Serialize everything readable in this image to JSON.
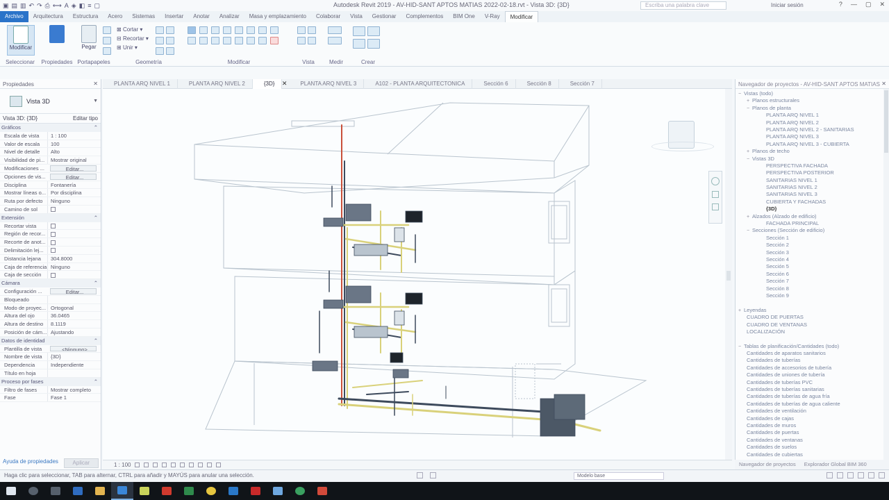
{
  "window": {
    "title": "Autodesk Revit 2019 - AV-HID-SANT APTOS MATIAS 2022-02-18.rvt - Vista 3D: {3D}",
    "search_placeholder": "Escriba una palabra clave",
    "user": "Iniciar sesión"
  },
  "ribbon_tabs": [
    "Archivo",
    "Arquitectura",
    "Estructura",
    "Acero",
    "Sistemas",
    "Insertar",
    "Anotar",
    "Analizar",
    "Masa y emplazamiento",
    "Colaborar",
    "Vista",
    "Gestionar",
    "Complementos",
    "BIM One",
    "V-Ray",
    "Modificar"
  ],
  "ribbon_groups": {
    "select": "Seleccionar",
    "properties": "Propiedades",
    "clipboard": "Portapapeles",
    "geometry": "Geometría",
    "modify": "Modificar",
    "view": "Vista",
    "measure": "Medir",
    "create": "Crear",
    "modify_btn": "Modificar",
    "paste_btn": "Pegar",
    "cut_label": "Recortar",
    "join_label": "Unir",
    "cope_label": "Cortar"
  },
  "properties": {
    "header": "Propiedades",
    "type_name": "Vista 3D",
    "view_selector": "Vista 3D: {3D}",
    "edit_type": "Editar tipo",
    "rows": [
      {
        "cat": "Gráficos"
      },
      {
        "k": "Escala de vista",
        "v": "1 : 100"
      },
      {
        "k": "Valor de escala",
        "v": "100"
      },
      {
        "k": "Nivel de detalle",
        "v": "Alto"
      },
      {
        "k": "Visibilidad de pi...",
        "v": "Mostrar original"
      },
      {
        "k": "Modificaciones ...",
        "v": "Editar...",
        "btn": true
      },
      {
        "k": "Opciones de vis...",
        "v": "Editar...",
        "btn": true
      },
      {
        "k": "Disciplina",
        "v": "Fontanería"
      },
      {
        "k": "Mostrar líneas o...",
        "v": "Por disciplina"
      },
      {
        "k": "Ruta por defecto",
        "v": "Ninguno"
      },
      {
        "k": "Camino de sol",
        "v": "",
        "cb": true
      },
      {
        "cat": "Extensión"
      },
      {
        "k": "Recortar vista",
        "v": "",
        "cb": true
      },
      {
        "k": "Región de recor...",
        "v": "",
        "cb": true
      },
      {
        "k": "Recorte de anot...",
        "v": "",
        "cb": true
      },
      {
        "k": "Delimitación lej...",
        "v": "",
        "cb": true
      },
      {
        "k": "Distancia lejana",
        "v": "304.8000"
      },
      {
        "k": "Caja de referencia",
        "v": "Ninguno"
      },
      {
        "k": "Caja de sección",
        "v": "",
        "cb": true
      },
      {
        "cat": "Cámara"
      },
      {
        "k": "Configuración ...",
        "v": "Editar...",
        "btn": true
      },
      {
        "k": "Bloqueado",
        "v": ""
      },
      {
        "k": "Modo de proyec...",
        "v": "Ortogonal"
      },
      {
        "k": "Altura del ojo",
        "v": "36.0465"
      },
      {
        "k": "Altura de destino",
        "v": "8.1119"
      },
      {
        "k": "Posición de cám...",
        "v": "Ajustando"
      },
      {
        "cat": "Datos de identidad"
      },
      {
        "k": "Plantilla de vista",
        "v": "<Ninguno>",
        "btn": true
      },
      {
        "k": "Nombre de vista",
        "v": "{3D}"
      },
      {
        "k": "Dependencia",
        "v": "Independiente"
      },
      {
        "k": "Título en hoja",
        "v": ""
      },
      {
        "cat": "Proceso por fases"
      },
      {
        "k": "Filtro de fases",
        "v": "Mostrar completo"
      },
      {
        "k": "Fase",
        "v": "Fase 1"
      }
    ],
    "help_link": "Ayuda de propiedades",
    "apply": "Aplicar"
  },
  "view_tabs": [
    {
      "label": "PLANTA ARQ NIVEL 1"
    },
    {
      "label": "PLANTA ARQ NIVEL 2"
    },
    {
      "label": "{3D}",
      "active": true
    },
    {
      "label": "PLANTA ARQ NIVEL 3"
    },
    {
      "label": "A102 - PLANTA ARQUITECTONICA"
    },
    {
      "label": "Sección 6"
    },
    {
      "label": "Sección 8"
    },
    {
      "label": "Sección 7"
    }
  ],
  "view_scale": "1 : 100",
  "browser": {
    "header": "Navegador de proyectos - AV-HID-SANT APTOS MATIAS",
    "items": [
      {
        "t": "Vistas (todo)",
        "l": 0,
        "tog": "−"
      },
      {
        "t": "Planos estructurales",
        "l": 1,
        "tog": "+"
      },
      {
        "t": "Planos de planta",
        "l": 1,
        "tog": "−"
      },
      {
        "t": "PLANTA ARQ NIVEL 1",
        "l": 2
      },
      {
        "t": "PLANTA ARQ NIVEL 2",
        "l": 2
      },
      {
        "t": "PLANTA ARQ NIVEL 2 - SANITARIAS",
        "l": 2
      },
      {
        "t": "PLANTA ARQ NIVEL 3",
        "l": 2
      },
      {
        "t": "PLANTA ARQ NIVEL 3 - CUBIERTA",
        "l": 2
      },
      {
        "t": "Planos de techo",
        "l": 1,
        "tog": "+"
      },
      {
        "t": "Vistas 3D",
        "l": 1,
        "tog": "−"
      },
      {
        "t": "PERSPECTIVA FACHADA",
        "l": 2
      },
      {
        "t": "PERSPECTIVA POSTERIOR",
        "l": 2
      },
      {
        "t": "SANITARIAS NIVEL 1",
        "l": 2
      },
      {
        "t": "SANITARIAS NIVEL 2",
        "l": 2
      },
      {
        "t": "SANITARIAS NIVEL 3",
        "l": 2
      },
      {
        "t": "CUBIERTA Y FACHADAS",
        "l": 2
      },
      {
        "t": "{3D}",
        "l": 2,
        "bold": true
      },
      {
        "t": "Alzados (Alzado de edificio)",
        "l": 1,
        "tog": "+"
      },
      {
        "t": "FACHADA PRINCIPAL",
        "l": 2
      },
      {
        "t": "Secciones (Sección de edificio)",
        "l": 1,
        "tog": "−"
      },
      {
        "t": "Sección 1",
        "l": 2
      },
      {
        "t": "Sección 2",
        "l": 2
      },
      {
        "t": "Sección 3",
        "l": 2
      },
      {
        "t": "Sección 4",
        "l": 2
      },
      {
        "t": "Sección 5",
        "l": 2
      },
      {
        "t": "Sección 6",
        "l": 2
      },
      {
        "t": "Sección 7",
        "l": 2
      },
      {
        "t": "Sección 8",
        "l": 2
      },
      {
        "t": "Sección 9",
        "l": 2
      },
      {
        "t": "",
        "l": 0
      },
      {
        "t": "Leyendas",
        "l": 0,
        "tog": "+"
      },
      {
        "t": "CUADRO DE PUERTAS",
        "l": 1
      },
      {
        "t": "CUADRO DE VENTANAS",
        "l": 1
      },
      {
        "t": "LOCALIZACIÓN",
        "l": 1
      },
      {
        "t": "",
        "l": 0
      },
      {
        "t": "Tablas de planificación/Cantidades (todo)",
        "l": 0,
        "tog": "−"
      },
      {
        "t": "Cantidades de aparatos sanitarios",
        "l": 1
      },
      {
        "t": "Cantidades de tuberías",
        "l": 1
      },
      {
        "t": "Cantidades de accesorios de tubería",
        "l": 1
      },
      {
        "t": "Cantidades de uniones de tubería",
        "l": 1
      },
      {
        "t": "Cantidades de tuberías PVC",
        "l": 1
      },
      {
        "t": "Cantidades de tuberías sanitarias",
        "l": 1
      },
      {
        "t": "Cantidades de tuberías de agua fría",
        "l": 1
      },
      {
        "t": "Cantidades de tuberías de agua caliente",
        "l": 1
      },
      {
        "t": "Cantidades de ventilación",
        "l": 1
      },
      {
        "t": "Cantidades de cajas",
        "l": 1
      },
      {
        "t": "Cantidades de muros",
        "l": 1
      },
      {
        "t": "Cantidades de puertas",
        "l": 1
      },
      {
        "t": "Cantidades de ventanas",
        "l": 1
      },
      {
        "t": "Cantidades de suelos",
        "l": 1
      },
      {
        "t": "Cantidades de cubiertas",
        "l": 1
      }
    ],
    "footer_tabs": [
      "Navegador de proyectos",
      "Explorador Global BIM 360"
    ]
  },
  "status": {
    "message": "Haga clic para seleccionar, TAB para alternar, CTRL para añadir y MAYÚS para anular una selección.",
    "model": "Modelo base"
  },
  "colors": {
    "file_tab": "#2a73c9",
    "pipe_yellow": "#d9d17a",
    "pipe_dark": "#3d4a5c",
    "pipe_red": "#c9503a"
  }
}
